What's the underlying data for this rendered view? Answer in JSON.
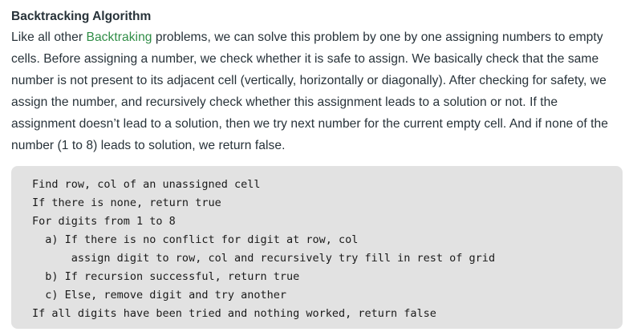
{
  "article": {
    "title": "Backtracking Algorithm",
    "para_before_link": "Like all other ",
    "link_text": "Backtraking",
    "para_after_link": " problems, we can solve this problem by one by one assigning numbers to empty cells. Before assigning a number, we check whether it is safe to assign. We basically check that the same number is not present to its adjacent cell (vertically, horizontally or diagonally). After checking for safety, we assign the number, and recursively check whether this assignment leads to a solution or not. If the assignment doesn’t lead to a solution, then we try next number for the current empty cell. And if none of the number (1 to 8) leads to solution, we return false.",
    "link_color": "#2f8d46"
  },
  "code": {
    "lines": [
      "Find row, col of an unassigned cell",
      "If there is none, return true",
      "For digits from 1 to 8",
      "  a) If there is no conflict for digit at row, col",
      "      assign digit to row, col and recursively try fill in rest of grid",
      "  b) If recursion successful, return true",
      "  c) Else, remove digit and try another",
      "If all digits have been tried and nothing worked, return false"
    ]
  }
}
